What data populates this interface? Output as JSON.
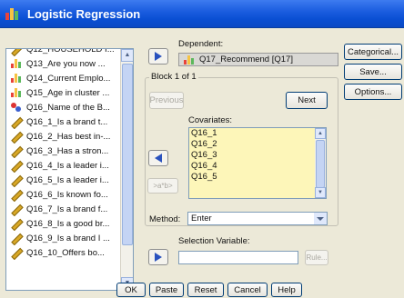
{
  "window": {
    "title": "Logistic Regression"
  },
  "variables": [
    {
      "label": "Q12_HOUSEHOLD I...",
      "type": "pencil"
    },
    {
      "label": "Q13_Are you now ...",
      "type": "bars"
    },
    {
      "label": "Q14_Current Emplo...",
      "type": "bars"
    },
    {
      "label": "Q15_Age in cluster ...",
      "type": "bars"
    },
    {
      "label": "Q16_Name of the B...",
      "type": "nominal"
    },
    {
      "label": "Q16_1_Is a brand t...",
      "type": "pencil"
    },
    {
      "label": "Q16_2_Has best in-...",
      "type": "pencil"
    },
    {
      "label": "Q16_3_Has a stron...",
      "type": "pencil"
    },
    {
      "label": "Q16_4_Is a leader i...",
      "type": "pencil"
    },
    {
      "label": "Q16_5_Is a leader i...",
      "type": "pencil"
    },
    {
      "label": "Q16_6_Is known fo...",
      "type": "pencil"
    },
    {
      "label": "Q16_7_Is a brand f...",
      "type": "pencil"
    },
    {
      "label": "Q16_8_Is a good br...",
      "type": "pencil"
    },
    {
      "label": "Q16_9_Is a brand I ...",
      "type": "pencil"
    },
    {
      "label": "Q16_10_Offers bo...",
      "type": "pencil"
    }
  ],
  "dependent": {
    "label": "Dependent:",
    "value": "Q17_Recommend [Q17]"
  },
  "block": {
    "title": "Block 1 of 1",
    "previous": "Previous",
    "next": "Next",
    "covariates_label": "Covariates:",
    "covariates": [
      "Q16_1",
      "Q16_2",
      "Q16_3",
      "Q16_4",
      "Q16_5"
    ],
    "interaction_button": ">a*b>",
    "method_label": "Method:",
    "method_value": "Enter"
  },
  "selection": {
    "label": "Selection Variable:",
    "rule_button": "Rule..."
  },
  "side_buttons": [
    "Categorical...",
    "Save...",
    "Options..."
  ],
  "bottom_buttons": [
    "OK",
    "Paste",
    "Reset",
    "Cancel",
    "Help"
  ],
  "colors": {
    "titlebar": "#1c5ee0",
    "covariate_bg": "#fdf6b9",
    "accent": "#2a52be"
  }
}
